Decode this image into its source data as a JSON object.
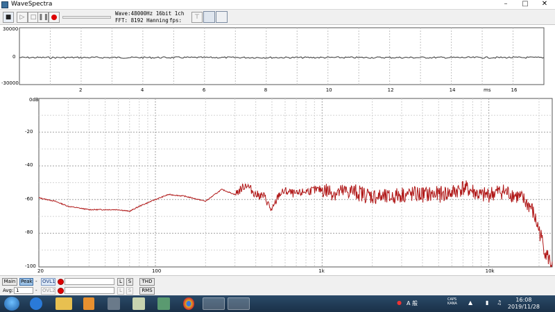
{
  "window": {
    "title": "WaveSpectra",
    "minimize": "–",
    "maximize": "□",
    "close": "✕"
  },
  "toolbar": {
    "wave_info": "Wave:48000Hz 16bit 1ch",
    "fft_info": "FFT: 8192 Hanning",
    "fps_label": "fps:"
  },
  "waveform": {
    "y_ticks": [
      "30000",
      "0",
      "-30000"
    ],
    "x_ticks": [
      "2",
      "4",
      "6",
      "8",
      "10",
      "12",
      "14",
      "16"
    ],
    "x_unit": "ms"
  },
  "spectrum": {
    "y_ticks": [
      "0dB",
      "-20",
      "-40",
      "-60",
      "-80",
      "-100"
    ],
    "x_ticks": [
      "20",
      "100",
      "1k",
      "10k"
    ],
    "trace_color": "#b01818"
  },
  "chart_data": {
    "type": "line",
    "title": "",
    "xlabel": "",
    "ylabel": "",
    "x_scale": "log",
    "xlim": [
      20,
      24000
    ],
    "ylim": [
      -100,
      0
    ],
    "grid": true,
    "series": [
      {
        "x": [
          20,
          25,
          30,
          40,
          50,
          60,
          70,
          80,
          100,
          120,
          150,
          200,
          250,
          300,
          350,
          400,
          450,
          500,
          550,
          600,
          700,
          800,
          1000,
          1200,
          1500,
          2000,
          2500,
          3000,
          4000,
          5000,
          6000,
          7000,
          8000,
          9000,
          10000,
          12000,
          14000,
          16000,
          18000,
          20000,
          22000,
          24000
        ],
        "y": [
          -59,
          -61,
          -64,
          -66,
          -66,
          -66,
          -67,
          -64,
          -60,
          -57,
          -58,
          -61,
          -54,
          -57,
          -51,
          -57,
          -58,
          -67,
          -57,
          -55,
          -57,
          -55,
          -54,
          -56,
          -55,
          -58,
          -59,
          -57,
          -57,
          -57,
          -56,
          -53,
          -55,
          -58,
          -57,
          -55,
          -57,
          -60,
          -65,
          -78,
          -92,
          -99
        ]
      }
    ]
  },
  "bottom_bar": {
    "row1": {
      "main": "Main",
      "peak": "Peak",
      "ovl1": "OVL1",
      "l": "L",
      "s": "S",
      "thd": "THD"
    },
    "row2": {
      "avg_label": "Avg:",
      "avg_value": "1",
      "ovl2": "OVL2",
      "l": "L",
      "s": "S",
      "rms": "RMS"
    }
  },
  "taskbar": {
    "time": "16:08",
    "date": "2019/11/28",
    "ime": "A 般",
    "caps": "CAPS",
    "kana": "KANA"
  }
}
